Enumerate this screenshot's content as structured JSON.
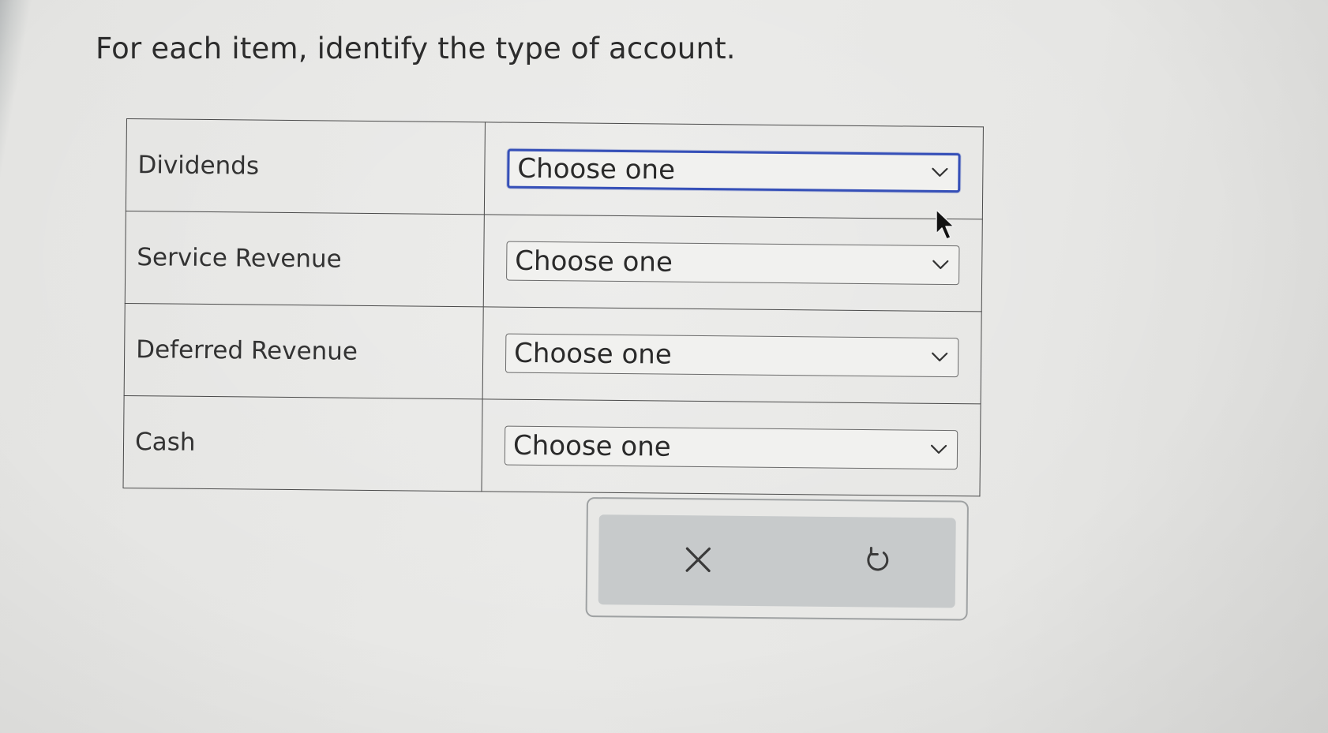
{
  "prompt": "For each item, identify the type of account.",
  "rows": [
    {
      "item": "Dividends",
      "selected": "Choose one"
    },
    {
      "item": "Service Revenue",
      "selected": "Choose one"
    },
    {
      "item": "Deferred Revenue",
      "selected": "Choose one"
    },
    {
      "item": "Cash",
      "selected": "Choose one"
    }
  ],
  "actions": {
    "clear_icon": "close-icon",
    "undo_icon": "undo-icon"
  },
  "colors": {
    "focus_border": "#3650b8",
    "table_border": "#4a4a4a",
    "action_panel_bg": "#c7cacb"
  }
}
